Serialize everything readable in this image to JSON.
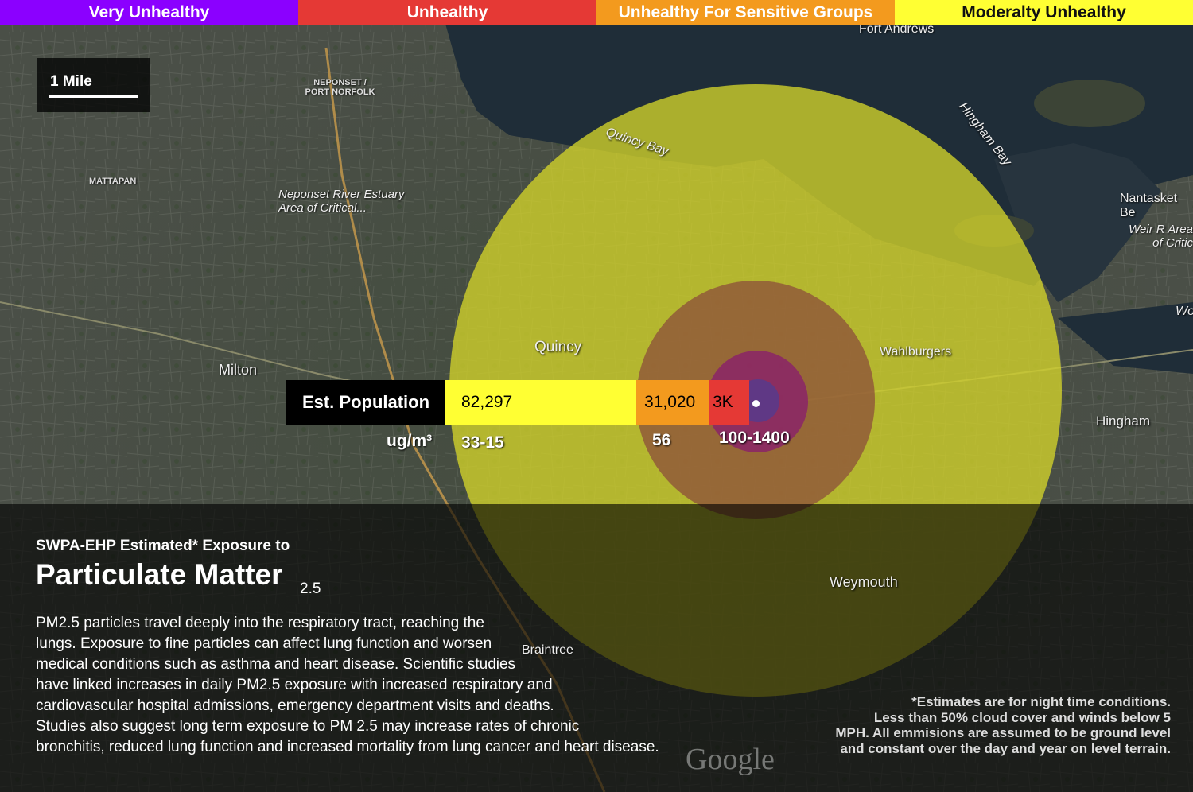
{
  "legend": [
    {
      "label": "Very Unhealthy",
      "color": "#8b00ff"
    },
    {
      "label": "Unhealthy",
      "color": "#e53935"
    },
    {
      "label": "Unhealthy For Sensitive Groups",
      "color": "#f39a1e"
    },
    {
      "label": "Moderalty Unhealthy",
      "color": "#ffff33"
    }
  ],
  "scale": {
    "label": "1 Mile"
  },
  "population": {
    "label": "Est. Population",
    "moderately_unhealthy": "82,297",
    "sensitive_groups": "31,020",
    "unhealthy": "3K"
  },
  "concentration": {
    "unit_label": "ug/m³",
    "moderately_unhealthy": "33-15",
    "sensitive_groups": "56",
    "unhealthy": "100-1400"
  },
  "places": {
    "fort_andrews": "Fort Andrews",
    "neponset": "NEPONSET / PORT NORFOLK",
    "mattapan": "MATTAPAN",
    "estuary": "Neponset River Estuary Area of Critical...",
    "quincy_bay": "Quincy Bay",
    "hingham_bay": "Hingham Bay",
    "nantasket": "Nantasket Be",
    "weir": "Weir R Area of Critic",
    "wo": "Wo",
    "quincy": "Quincy",
    "milton": "Milton",
    "wahlburgers": "Wahlburgers",
    "hingham": "Hingham",
    "weymouth": "Weymouth",
    "braintree": "Braintree",
    "google": "Google"
  },
  "info": {
    "subtitle": "SWPA-EHP Estimated* Exposure to",
    "title": "Particulate Matter",
    "title_sub": "2.5",
    "description": "PM2.5 particles travel deeply into the respiratory tract, reaching the\nlungs. Exposure to fine particles can affect lung function and worsen\nmedical conditions such as asthma and heart disease. Scientific studies\nhave linked increases in daily PM2.5 exposure with increased respiratory and\ncardiovascular hospital admissions, emergency department visits and deaths.\nStudies also suggest long term exposure to PM 2.5 may increase rates  of chronic\nbronchitis, reduced lung function and increased mortality from lung cancer and heart disease.",
    "footnote": "*Estimates are for night time conditions.\nLess than 50% cloud cover and winds below 5\nMPH. All emmisions are assumed to be ground level\nand constant over the day and year on level terrain."
  },
  "colors": {
    "moderate_zone": "#d4d42a",
    "sensitive_zone": "#8a4a3a",
    "unhealthy_zone": "#8a1f6a",
    "very_unhealthy_zone": "#5a3a8a"
  }
}
